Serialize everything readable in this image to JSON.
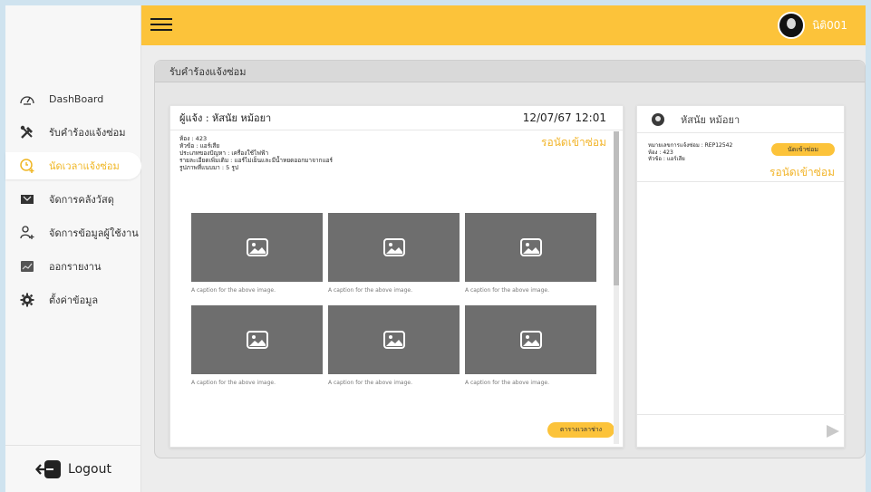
{
  "sidebar": {
    "items": [
      {
        "label": "DashBoard",
        "icon": "gauge-icon"
      },
      {
        "label": "รับคำร้องแจ้งซ่อม",
        "icon": "tools-icon"
      },
      {
        "label": "นัดเวลาแจ้งซ่อม",
        "icon": "clock-plus-icon"
      },
      {
        "label": "จัดการคลังวัสดุ",
        "icon": "box-icon"
      },
      {
        "label": "จัดการข้อมูลผู้ใช้งาน",
        "icon": "user-add-icon"
      },
      {
        "label": "ออกรายงาน",
        "icon": "report-icon"
      },
      {
        "label": "ตั้งค่าข้อมูล",
        "icon": "gear-icon"
      }
    ],
    "active_index": 2,
    "logout_label": "Logout"
  },
  "topbar": {
    "user_name": "นิติ001",
    "accent_color": "#fcc33a"
  },
  "page": {
    "title": "รับคำร้องแจ้งซ่อม"
  },
  "report": {
    "reporter": "ผู้แจ้ง : หัสนัย หม้อยา",
    "datetime": "12/07/67 12:01",
    "status": "รอนัดเข้าซ่อม",
    "details": [
      "ห้อง : 423",
      "หัวข้อ : แอร์เสีย",
      "ประเภทของปัญหา : เครื่องใช้ไฟฟ้า",
      "รายละเอียดเพิ่มเติม : แอร์ไม่เย็นและมีน้ำหยดออกมาจากแอร์",
      "รูปภาพที่แนบมา : 5 รูป"
    ],
    "images": [
      {
        "caption": "A caption for the above image."
      },
      {
        "caption": "A caption for the above image."
      },
      {
        "caption": "A caption for the above image."
      },
      {
        "caption": "A caption for the above image."
      },
      {
        "caption": "A caption for the above image."
      },
      {
        "caption": "A caption for the above image."
      }
    ],
    "schedule_button": "ตารางเวลาช่าง"
  },
  "chat": {
    "name": "หัสนัย หม้อยา",
    "request": {
      "lines": [
        "หมายเลขการแจ้งซ่อม : REP12542",
        "ห้อง : 423",
        "หัวข้อ : แอร์เสีย"
      ],
      "appoint_button": "นัดเข้าซ่อม",
      "status": "รอนัดเข้าซ่อม"
    },
    "input_placeholder": ""
  }
}
